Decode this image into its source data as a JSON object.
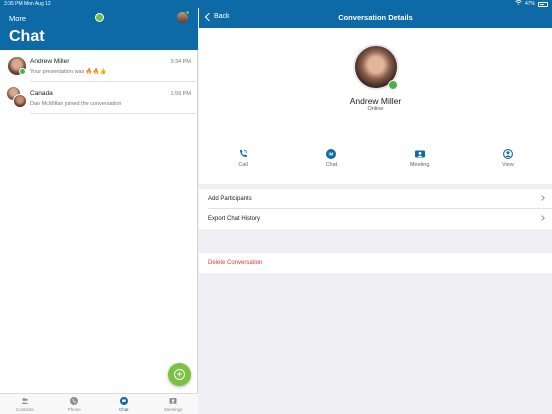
{
  "statusbar": {
    "time_date": "3:35 PM   Mon Aug 12",
    "battery": "47%"
  },
  "left": {
    "more_label": "More",
    "title": "Chat",
    "conversations": [
      {
        "name": "Andrew Miller",
        "time": "3:34 PM",
        "preview": "Your presentation was 🔥🔥👍"
      },
      {
        "name": "Canada",
        "time": "1:59 PM",
        "preview": "Dan McMillan joined the conversation"
      }
    ],
    "tabs": [
      {
        "label": "Contacts",
        "icon": "contacts-icon"
      },
      {
        "label": "Phone",
        "icon": "phone-icon"
      },
      {
        "label": "Chat",
        "icon": "chat-icon"
      },
      {
        "label": "Meetings",
        "icon": "meetings-icon"
      }
    ]
  },
  "right": {
    "back_label": "Back",
    "title": "Conversation Details",
    "contact": {
      "name": "Andrew Miller",
      "status": "Online"
    },
    "actions": [
      {
        "label": "Call",
        "icon": "call-icon"
      },
      {
        "label": "Chat",
        "icon": "im-icon"
      },
      {
        "label": "Meeting",
        "icon": "meeting-icon"
      },
      {
        "label": "View",
        "icon": "view-icon"
      }
    ],
    "rows": {
      "add_participants": "Add Participants",
      "export_history": "Export Chat History",
      "delete": "Delete Conversation"
    }
  },
  "colors": {
    "brand": "#0e6aa6",
    "accent_green": "#7cc242",
    "online": "#4caf50",
    "danger": "#e4373a"
  }
}
